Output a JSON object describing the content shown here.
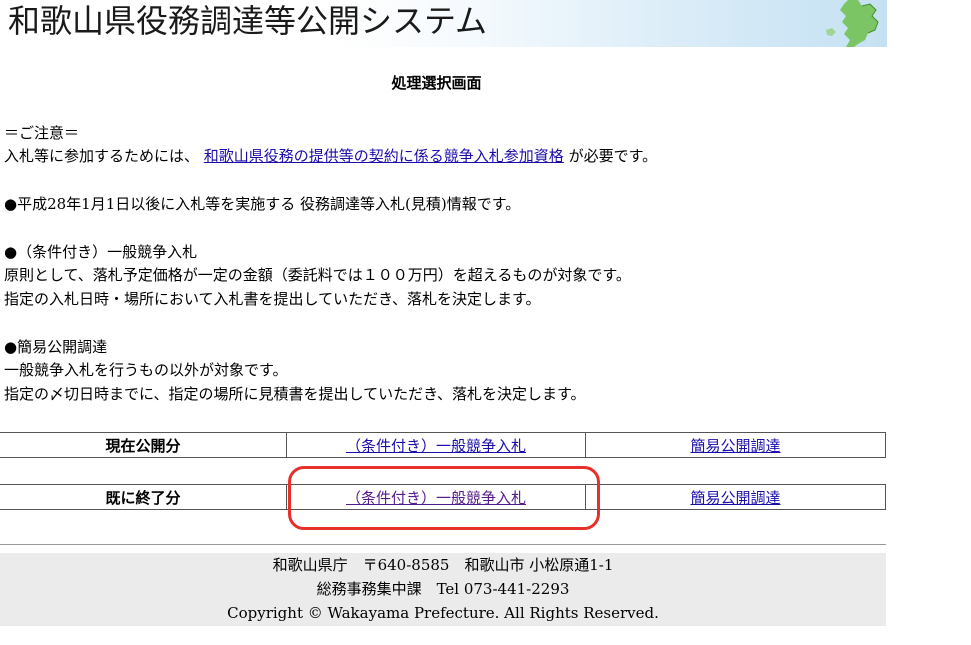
{
  "header": {
    "site_title": "和歌山県役務調達等公開システム"
  },
  "page": {
    "heading": "処理選択画面"
  },
  "notice": {
    "caution_heading": "＝ご注意＝",
    "requirement_prefix": "入札等に参加するためには、",
    "requirement_link": "和歌山県役務の提供等の契約に係る競争入札参加資格",
    "requirement_suffix": " が必要です。",
    "scope": "●平成28年1月1日以後に入札等を実施する 役務調達等入札(見積)情報です。",
    "general_heading": "●（条件付き）一般競争入札",
    "general_line1": "原則として、落札予定価格が一定の金額（委託料では１００万円）を超えるものが対象です。",
    "general_line2": "指定の入札日時・場所において入札書を提出していただき、落札を決定します。",
    "simple_heading": "●簡易公開調達",
    "simple_line1": "一般競争入札を行うもの以外が対象です。",
    "simple_line2": "指定の〆切日時までに、指定の場所に見積書を提出していただき、落札を決定します。"
  },
  "menu": {
    "current": {
      "label": "現在公開分",
      "general_link": "（条件付き）一般競争入札",
      "simple_link": "簡易公開調達"
    },
    "finished": {
      "label": "既に終了分",
      "general_link": "（条件付き）一般競争入札",
      "simple_link": "簡易公開調達"
    }
  },
  "footer": {
    "line1": "和歌山県庁　〒640-8585　和歌山市 小松原通1-1",
    "line2": "総務事務集中課　Tel 073-441-2293",
    "line3": "Copyright © Wakayama Prefecture. All Rights Reserved."
  },
  "colors": {
    "link": "#1a0dab",
    "visited_link": "#551a8b",
    "highlight": "#e8302a",
    "footer_bg": "#ebebeb"
  }
}
